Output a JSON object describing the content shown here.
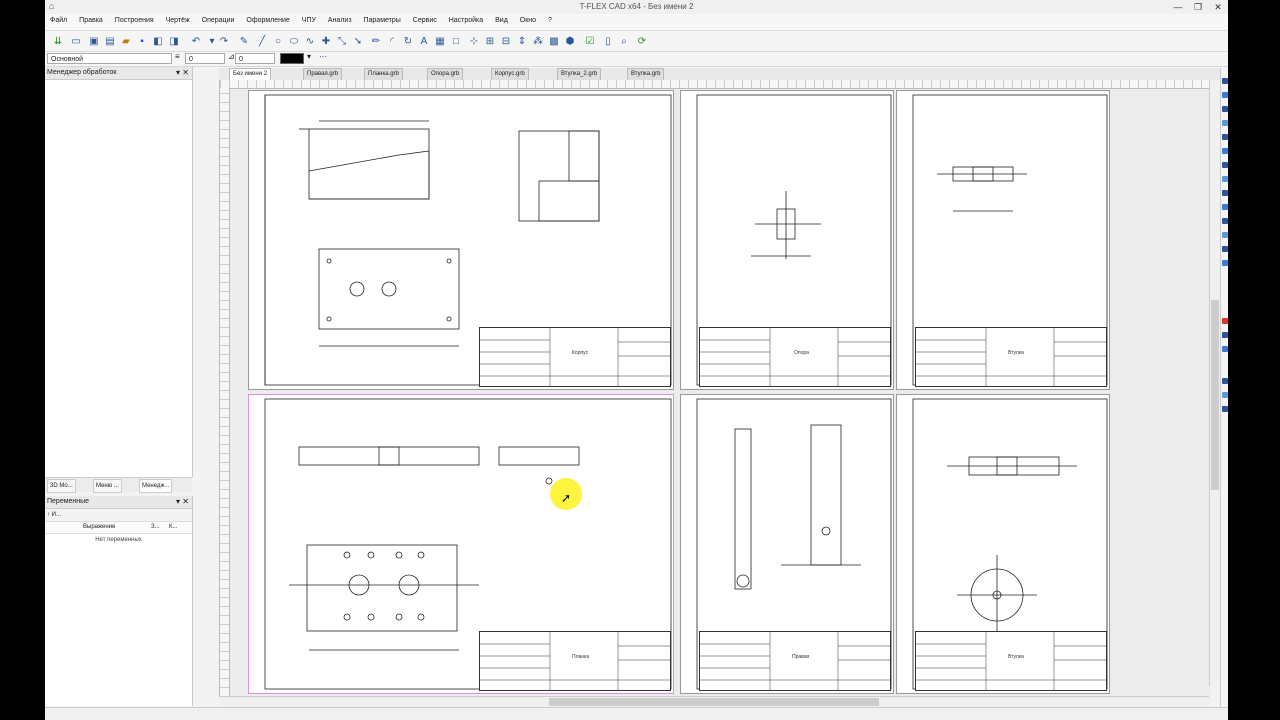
{
  "window": {
    "title": "T-FLEX CAD x64 - Без имени 2",
    "minimize": "—",
    "restore": "❐",
    "close": "✕"
  },
  "menu": [
    "Файл",
    "Правка",
    "Построения",
    "Чертёж",
    "Операции",
    "Оформление",
    "ЧПУ",
    "Анализ",
    "Параметры",
    "Сервис",
    "Настройка",
    "Вид",
    "Окно",
    "?"
  ],
  "toolbar2": {
    "layer": "Основной",
    "field1": "0",
    "field2": "0"
  },
  "left_panel": {
    "manager_title": "Менеджер обработок",
    "tabs": [
      "3D Мо...",
      "Меню ...",
      "Менедж..."
    ],
    "variables_title": "Переменные",
    "vars_toolbar": "↑ И... ",
    "vars_col_expr": "Выражение",
    "vars_col_s": "З...",
    "vars_col_k": "К...",
    "vars_empty": "Нет переменных"
  },
  "doc_tabs": [
    "Без имени 2",
    "Правая.grb",
    "Планка.grb",
    "Опора.grb",
    "Корпус.grb",
    "Втулка_2.grb",
    "Втулка.grb"
  ],
  "sheets": [
    {
      "name": "Корпус"
    },
    {
      "name": "Опора"
    },
    {
      "name": "Втулка"
    },
    {
      "name": "Планка"
    },
    {
      "name": "Правая"
    },
    {
      "name": "Втулка"
    }
  ],
  "colors": {
    "accent": "#2b5797",
    "selection": "#e28ee8",
    "cursor": "#fff000"
  }
}
